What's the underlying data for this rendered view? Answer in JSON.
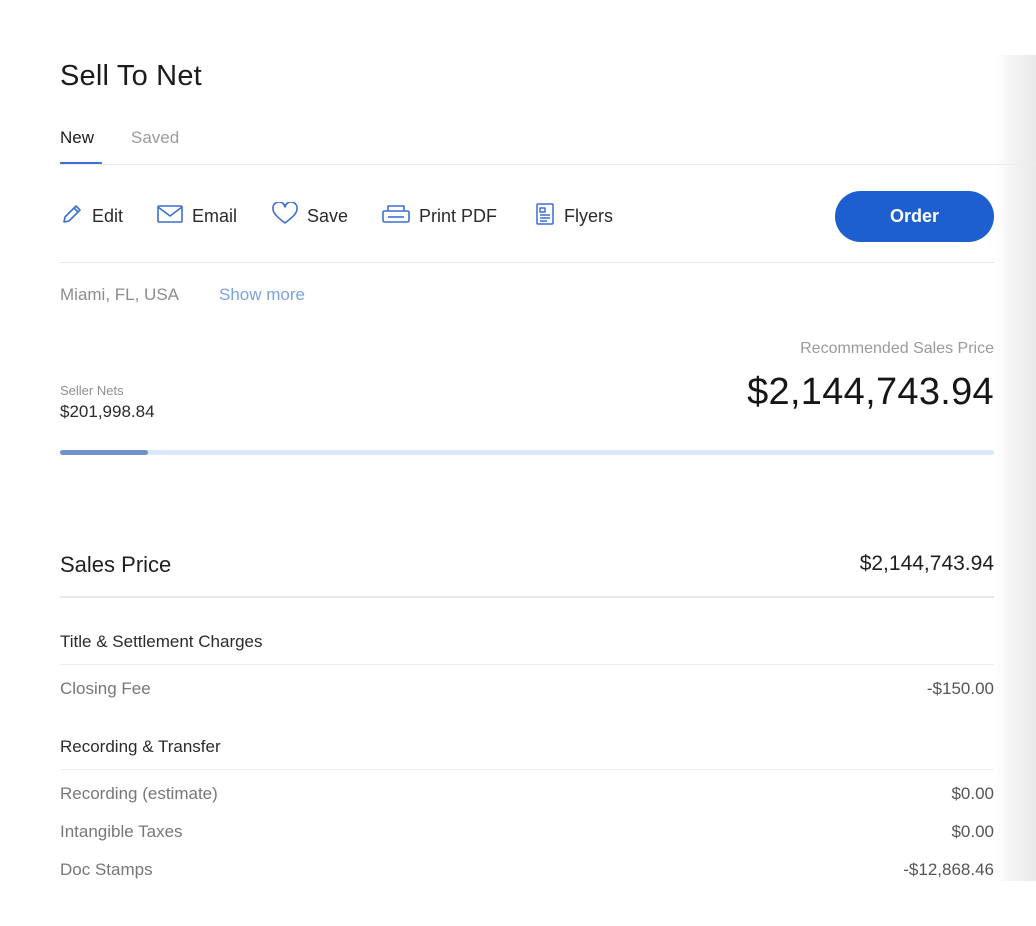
{
  "page": {
    "title": "Sell To Net"
  },
  "tabs": [
    {
      "label": "New",
      "active": true
    },
    {
      "label": "Saved",
      "active": false
    }
  ],
  "toolbar": {
    "edit_label": "Edit",
    "email_label": "Email",
    "save_label": "Save",
    "print_label": "Print PDF",
    "flyers_label": "Flyers",
    "order_label": "Order"
  },
  "location": {
    "text": "Miami, FL, USA",
    "show_more": "Show more"
  },
  "summary": {
    "recommended_label": "Recommended Sales Price",
    "recommended_value": "$2,144,743.94",
    "seller_nets_label": "Seller Nets",
    "seller_nets_value": "$201,998.84",
    "progress_fraction": 0.094
  },
  "sales_price": {
    "label": "Sales Price",
    "value": "$2,144,743.94"
  },
  "sections": {
    "title_settlement": {
      "heading": "Title & Settlement Charges",
      "rows": [
        {
          "label": "Closing Fee",
          "value": "-$150.00"
        }
      ]
    },
    "recording_transfer": {
      "heading": "Recording & Transfer",
      "rows": [
        {
          "label": "Recording (estimate)",
          "value": "$0.00"
        },
        {
          "label": "Intangible Taxes",
          "value": "$0.00"
        },
        {
          "label": "Doc Stamps",
          "value": "-$12,868.46"
        }
      ]
    }
  },
  "colors": {
    "accent": "#1e5fd0",
    "link": "#7ba3e3",
    "icon": "#3b6fd4",
    "progress_track": "#dbe7fa",
    "progress_fill": "#6f93c9"
  },
  "icons": [
    "pencil-icon",
    "envelope-icon",
    "heart-icon",
    "printer-icon",
    "document-icon"
  ]
}
